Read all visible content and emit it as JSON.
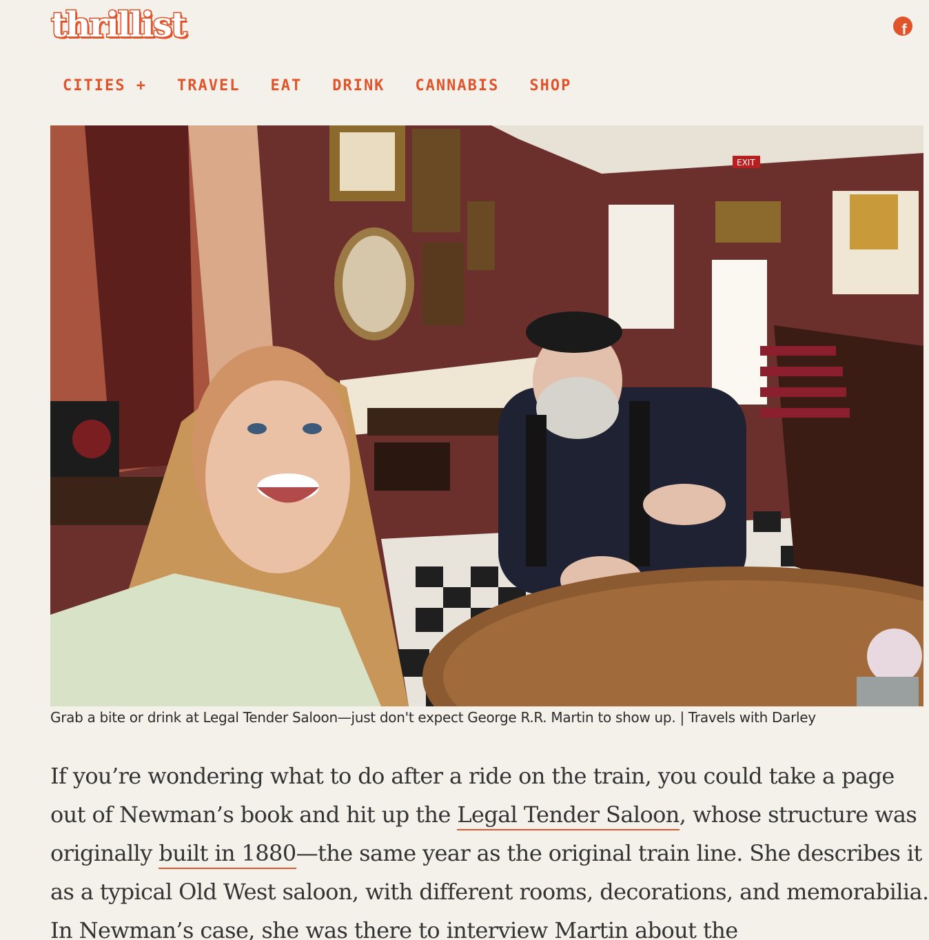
{
  "brand": {
    "logo_text": "thrillist",
    "accent_color": "#e0542c"
  },
  "header": {
    "social_icon": "facebook-icon",
    "social_glyph": "f"
  },
  "nav": {
    "items": [
      {
        "label": "CITIES +"
      },
      {
        "label": "TRAVEL"
      },
      {
        "label": "EAT"
      },
      {
        "label": "DRINK"
      },
      {
        "label": "CANNABIS"
      },
      {
        "label": "SHOP"
      }
    ]
  },
  "photo": {
    "exit_sign": "EXIT",
    "caption": "Grab a bite or drink at Legal Tender Saloon—just don't expect George R.R. Martin to show up. | Travels with Darley"
  },
  "article": {
    "p1_a": "If you’re wondering what to do after a ride on the train, you could take a page out of Newman’s book and hit up the ",
    "link1": "Legal Tender Saloon",
    "p1_b": ", whose structure was originally ",
    "link2": "built in 1880",
    "p1_c": "—the same year as the original train line. She describes it as a typical Old West saloon, with different rooms, decorations, and memorabilia. In Newman’s case, she was there to interview Martin about the"
  }
}
